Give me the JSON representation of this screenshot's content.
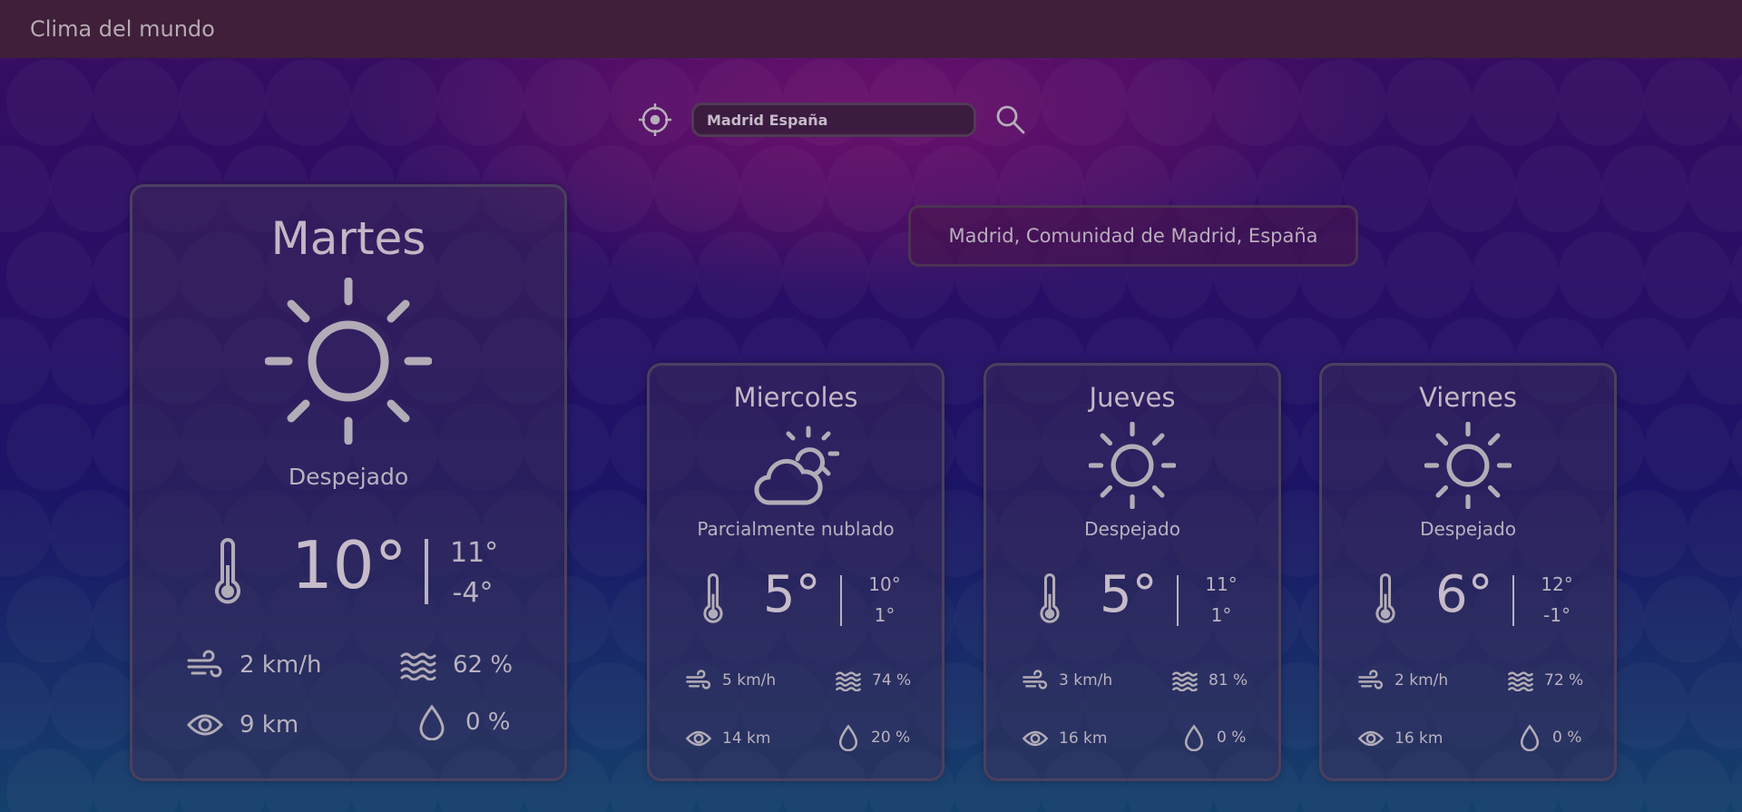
{
  "app": {
    "title": "Clima del mundo"
  },
  "search": {
    "value": "Madrid España",
    "placeholder": "Buscar ciudad"
  },
  "location": {
    "label": "Madrid, Comunidad de Madrid, España"
  },
  "icons": {
    "locate": "crosshair-icon",
    "search": "search-icon",
    "sunny": "sun-icon",
    "partly_cloudy": "partly-cloudy-icon",
    "thermometer": "thermometer-icon",
    "wind": "wind-icon",
    "humidity": "humidity-waves-icon",
    "visibility": "eye-icon",
    "precipitation": "drop-icon"
  },
  "today": {
    "day": "Martes",
    "condition": "Despejado",
    "temp": "10°",
    "high": "11°",
    "low": "-4°",
    "wind": "2 km/h",
    "humidity": "62 %",
    "visibility": "9 km",
    "precipitation": "0 %"
  },
  "forecast": [
    {
      "day": "Miercoles",
      "condition": "Parcialmente nublado",
      "temp": "5°",
      "high": "10°",
      "low": "1°",
      "wind": "5 km/h",
      "humidity": "74 %",
      "visibility": "14 km",
      "precipitation": "20 %"
    },
    {
      "day": "Jueves",
      "condition": "Despejado",
      "temp": "5°",
      "high": "11°",
      "low": "1°",
      "wind": "3 km/h",
      "humidity": "81 %",
      "visibility": "16 km",
      "precipitation": "0 %"
    },
    {
      "day": "Viernes",
      "condition": "Despejado",
      "temp": "6°",
      "high": "12°",
      "low": "-1°",
      "wind": "2 km/h",
      "humidity": "72 %",
      "visibility": "16 km",
      "precipitation": "0 %"
    }
  ]
}
